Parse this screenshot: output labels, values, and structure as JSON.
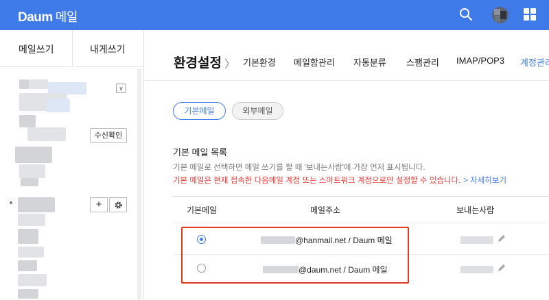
{
  "app": {
    "logo": "Daum",
    "service": "메일"
  },
  "sidebar": {
    "compose": "메일쓰기",
    "to_me": "내게쓰기",
    "check_mail": "수신확인",
    "add": "+"
  },
  "settings": {
    "title": "환경설정",
    "chevron": "〉",
    "nav": [
      "기본환경",
      "메일함관리",
      "자동분류",
      "스팸관리",
      "IMAP/POP3",
      "계정관리"
    ],
    "active_nav": "계정관리"
  },
  "tabs": {
    "basic": "기본메일",
    "external": "외부메일"
  },
  "basic_mail": {
    "section_title": "기본 메일 목록",
    "desc1": "기본 메일로 선택하면 메일 쓰기를 할 때 '보내는사람'에 가장 먼저 표시됩니다.",
    "desc2": "기본 메일은 현재 접속한 다음메일 계정 또는 스마트워크 계정으로만 설정할 수 있습니다.",
    "more_link": "> 자세히보기",
    "columns": [
      "기본메일",
      "메일주소",
      "보내는사람"
    ],
    "rows": [
      {
        "selected": true,
        "address_suffix": "@hanmail.net / Daum 메일"
      },
      {
        "selected": false,
        "address_suffix": "@daum.net / Daum 메일"
      }
    ]
  },
  "colors": {
    "brand": "#3f7be8",
    "warning": "#e53935",
    "highlight": "#e0391f"
  }
}
